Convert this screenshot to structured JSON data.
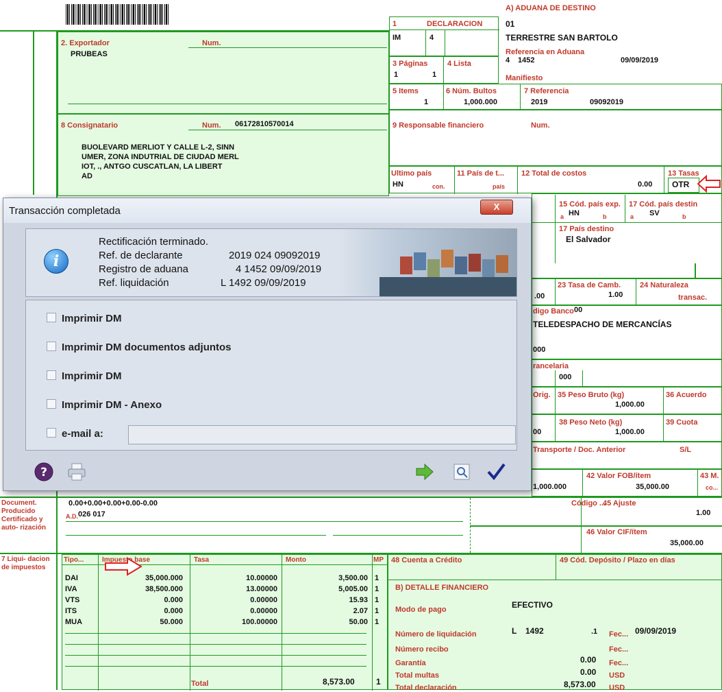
{
  "form": {
    "destino_label": "A) ADUANA DE DESTINO",
    "declaracion": {
      "label": "1",
      "title": "DECLARACION",
      "code1": "IM",
      "code2": "4",
      "dest_code": "01",
      "dest_name": "TERRESTRE SAN BARTOLO"
    },
    "ref_aduana": {
      "label": "Referencia en Aduana",
      "v1": "4",
      "v2": "1452",
      "date": "09/09/2019"
    },
    "paginas": {
      "label": "3 Páginas",
      "v1": "1",
      "v2": "1"
    },
    "lista": {
      "label": "4 Lista"
    },
    "manifiesto": {
      "label": "Manifiesto"
    },
    "items": {
      "label": "5 Items",
      "value": "1"
    },
    "bultos": {
      "label": "6 Núm. Bultos",
      "value": "1,000.000"
    },
    "referencia": {
      "label": "7 Referencia",
      "v1": "2019",
      "v2": "09092019"
    },
    "exportador": {
      "label": "2. Exportador",
      "num_label": "Num.",
      "name": "PRUBEAS"
    },
    "consignatario": {
      "label": "8 Consignatario",
      "num_label": "Num.",
      "num": "06172810570014",
      "addr1": "BUOLEVARD MERLIOT Y CALLE L-2, SINN",
      "addr2": "UMER, ZONA INDUTRIAL DE CIUDAD MERL",
      "addr3": "IOT, ., ANTGO CUSCATLAN, LA LIBERT",
      "addr4": "AD"
    },
    "responsable": {
      "label": "9 Responsable financiero",
      "num_label": "Num."
    },
    "ultimo_pais": {
      "label": "Ultimo país",
      "value": "HN",
      "sub": "con."
    },
    "pais_t": {
      "label": "11 País de t...",
      "sub": "país"
    },
    "total_costos": {
      "label": "12 Total de costos",
      "value": "0.00"
    },
    "tasas": {
      "label": "13 Tasas",
      "value": "OTR"
    },
    "cod_exp": {
      "label": "15 Cód. país exp.",
      "value": "HN",
      "a": "a",
      "b": "b"
    },
    "cod_dest": {
      "label": "17 Cód. país destin",
      "value": "SV",
      "a": "a",
      "b": "b"
    },
    "pais_destino": {
      "label": "17 País destino",
      "value": "El Salvador"
    },
    "tasa_camb": {
      "label": "23 Tasa de Camb.",
      "value": "1.00",
      "left": ".00"
    },
    "naturaleza": {
      "label": "24 Naturaleza",
      "sub": "transac."
    },
    "banco": {
      "label": "digo Banco",
      "value": "00",
      "name": "TELEDESPACHO DE MERCANCÍAS"
    },
    "misc": {
      "v000a": "000",
      "arancelaria": "rancelaria",
      "v000b": "000",
      "orig": "Orig.",
      "v0": "00"
    },
    "peso_bruto": {
      "label": "35 Peso Bruto (kg)",
      "value": "1,000.00"
    },
    "acuerdo": {
      "label": "36 Acuerdo"
    },
    "peso_neto": {
      "label": "38 Peso Neto (kg)",
      "value": "1,000.00"
    },
    "cuota": {
      "label": "39 Cuota"
    },
    "transporte": {
      "label": "Transporte / Doc. Anterior",
      "sl": "S/L"
    },
    "fob": {
      "label": "42 Valor FOB/ítem",
      "value": "35,000.00",
      "left": "1,000.000"
    },
    "mv": {
      "label": "43 M. V.",
      "sub": "co..."
    },
    "document": {
      "label": "Document. Producido Certificado y auto- rización",
      "formula": "0.00+0.00+0.00+0.00-0.00",
      "ad": "A.D.",
      "ad_value": "026 017"
    },
    "codigo": {
      "label": "Código ..."
    },
    "ajuste": {
      "label": "45 Ajuste",
      "value": "1.00"
    },
    "cif": {
      "label": "46 Valor CIF/ítem",
      "value": "35,000.00"
    },
    "liquidacion": {
      "label": "7 Liqui- dacion de impuestos",
      "headers": [
        "Tipo...",
        "Impuesto base",
        "Tasa",
        "Monto",
        "MP"
      ],
      "rows": [
        {
          "tipo": "DAI",
          "base": "35,000.000",
          "tasa": "10.00000",
          "monto": "3,500.00",
          "mp": "1"
        },
        {
          "tipo": "IVA",
          "base": "38,500.000",
          "tasa": "13.00000",
          "monto": "5,005.00",
          "mp": "1"
        },
        {
          "tipo": "VTS",
          "base": "0.000",
          "tasa": "0.00000",
          "monto": "15.93",
          "mp": "1"
        },
        {
          "tipo": "ITS",
          "base": "0.000",
          "tasa": "0.00000",
          "monto": "2.07",
          "mp": "1"
        },
        {
          "tipo": "MUA",
          "base": "50.000",
          "tasa": "100.00000",
          "monto": "50.00",
          "mp": "1"
        }
      ],
      "total_label": "Total",
      "total": "8,573.00",
      "total_mp": "1"
    },
    "cuenta": {
      "label": "48 Cuenta a Crédito"
    },
    "deposito": {
      "label": "49 Cód. Depósito / Plazo en días"
    },
    "detalle": {
      "title": "B) DETALLE FINANCIERO",
      "modo_label": "Modo de pago",
      "modo": "EFECTIVO",
      "num_liq_label": "Número de liquidación",
      "num_liq_l": "L",
      "num_liq": "1492",
      "num_liq_dot": ".1",
      "fec_label": "Fec...",
      "fec": "09/09/2019",
      "recibo_label": "Número recibo",
      "recibo_fec": "Fec...",
      "garantia_label": "Garantía",
      "garantia": "0.00",
      "garantia_fec": "Fec...",
      "multas_label": "Total multas",
      "multas": "0.00",
      "usd": "USD",
      "total_decl_label": "Total declaración",
      "total_decl": "8,573.00",
      "usd2": "USD"
    }
  },
  "dialog": {
    "title": "Transacción completada",
    "close": "X",
    "line1": "Rectificación terminado.",
    "r1_label": "Ref. de declarante",
    "r1_value": "2019 024 09092019",
    "r2_label": "Registro de aduana",
    "r2_value": "4 1452 09/09/2019",
    "r3_label": "Ref. liquidación",
    "r3_value": "L 1492 09/09/2019",
    "options": [
      "Imprimir DM",
      "Imprimir DM documentos adjuntos",
      "Imprimir DM",
      "Imprimir DM - Anexo"
    ],
    "email_label": "e-mail a:",
    "email_value": ""
  },
  "colors": {
    "label_red": "#c0392b",
    "box_green": "#1e9a1e",
    "fill_green": "#e4fbe2",
    "arrow_red": "#e02020"
  }
}
